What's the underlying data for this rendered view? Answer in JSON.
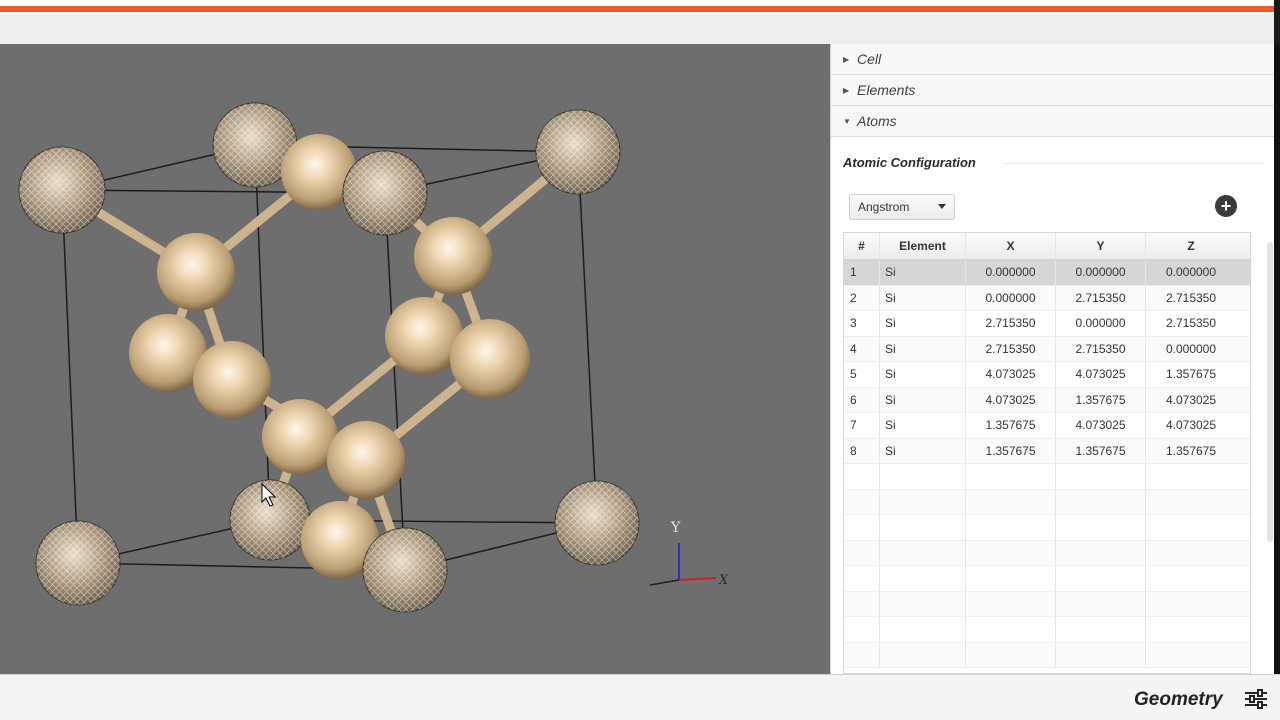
{
  "viewport": {
    "axis_labels": {
      "y": "Y",
      "x": "X"
    }
  },
  "panel": {
    "sections": [
      {
        "label": "Cell",
        "expanded": false
      },
      {
        "label": "Elements",
        "expanded": false
      },
      {
        "label": "Atoms",
        "expanded": true
      }
    ],
    "atoms": {
      "title": "Atomic Configuration",
      "unit": "Angstrom",
      "add_icon": "plus-circle-icon",
      "columns": [
        "#",
        "Element",
        "X",
        "Y",
        "Z"
      ],
      "rows": [
        [
          "1",
          "Si",
          "0.000000",
          "0.000000",
          "0.000000"
        ],
        [
          "2",
          "Si",
          "0.000000",
          "2.715350",
          "2.715350"
        ],
        [
          "3",
          "Si",
          "2.715350",
          "0.000000",
          "2.715350"
        ],
        [
          "4",
          "Si",
          "2.715350",
          "2.715350",
          "0.000000"
        ],
        [
          "5",
          "Si",
          "4.073025",
          "4.073025",
          "1.357675"
        ],
        [
          "6",
          "Si",
          "4.073025",
          "1.357675",
          "4.073025"
        ],
        [
          "7",
          "Si",
          "1.357675",
          "4.073025",
          "4.073025"
        ],
        [
          "8",
          "Si",
          "1.357675",
          "1.357675",
          "1.357675"
        ]
      ],
      "selected_row": 0
    }
  },
  "footer": {
    "title": "Geometry",
    "menu_icon": "settings-sliders-icon"
  },
  "colors": {
    "accent": "#f05a28",
    "viewport_bg": "#6e6e6e",
    "atom": "#e9d2b0",
    "selected_row": "#d6d6d6"
  }
}
